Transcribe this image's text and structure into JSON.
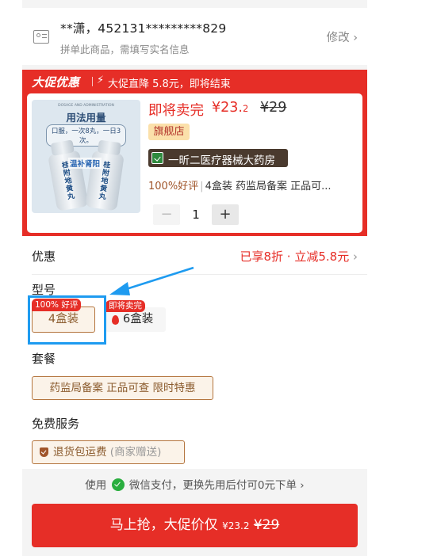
{
  "identity": {
    "name": "**潇，452131*********829",
    "hint": "拼单此商品，需填写实名信息",
    "edit_label": "修改",
    "edit_chevron": "›"
  },
  "promo": {
    "logo": "大促优惠",
    "bolt": "⚡",
    "text": "大促直降 5.8元，即将结束"
  },
  "product": {
    "image": {
      "top_small": "DOSAGE AND ADMINISTRATION",
      "title": "用法用量",
      "instruction": "口服，一次8丸，一日3次。",
      "bottle_label": "桂附地黄丸",
      "caption": "温补肾阳"
    },
    "status": "即将卖完",
    "price_main": "¥23.",
    "price_dec": "2",
    "price_old": "¥29",
    "flag_tag": "旗舰店",
    "store_name": "一昕二医疗器械大药房",
    "spec_good": "100%好评",
    "spec_bar": "|",
    "spec_rest": "4盒装 药监局备案 正品可...",
    "qty_minus": "−",
    "qty_value": "1",
    "qty_plus": "+"
  },
  "discount": {
    "label": "优惠",
    "value": "已享8折 · 立减5.8元",
    "chevron": "›"
  },
  "model": {
    "label": "型号",
    "options": [
      {
        "label": "4盒装",
        "badge": "100% 好评",
        "selected": true
      },
      {
        "label": "6盒装",
        "badge": "即将卖完",
        "selected": false
      }
    ]
  },
  "package": {
    "label": "套餐",
    "option": "药监局备案 正品可查 限时特惠"
  },
  "service": {
    "label": "免费服务",
    "option": "退货包运费",
    "note": "(商家赠送)"
  },
  "pay_hint": {
    "before": "使用",
    "after": "微信支付，更换先用后付可0元下单",
    "chevron": "›"
  },
  "buy_button": {
    "label": "马上抢，大促价仅 ",
    "price_main": "¥23.",
    "price_dec": "2",
    "price_old": "¥29"
  },
  "colors": {
    "accent_red": "#e62e27",
    "highlight_blue": "#1e9bf0",
    "chip_brown": "#b4753e",
    "wechat_green": "#2aae3f"
  }
}
